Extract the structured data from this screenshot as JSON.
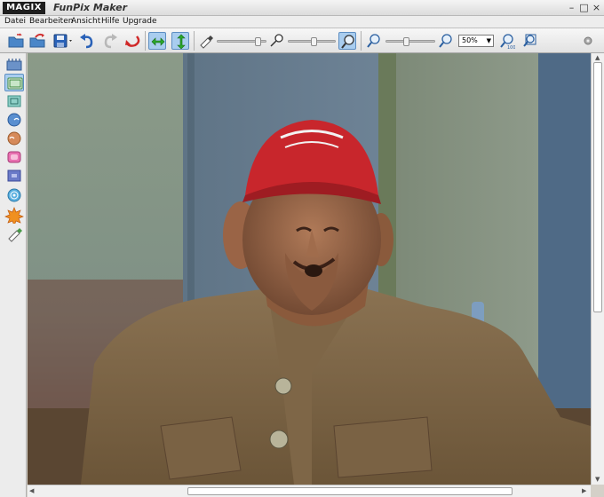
{
  "window": {
    "logo": "MAGIX",
    "title": "FunPix Maker",
    "minimize": "–",
    "maximize": "□",
    "close": "×"
  },
  "menu": {
    "items": [
      "Datei",
      "Bearbeiten",
      "Ansicht",
      "Hilfe",
      "Upgrade"
    ]
  },
  "toolbar": {
    "zoom_value": "50%",
    "zoom_options": [
      "50%"
    ],
    "slider1_level": 0.9,
    "slider2_level": 0.55,
    "slider3_level": 0.4,
    "mirror_horizontal_pressed": true,
    "mirror_vertical_pressed": true,
    "magnifier_pressed": true
  },
  "sidebar": {
    "tools": [
      "warp-tool-icon",
      "stretch-tool-icon",
      "move-tool-icon",
      "swirl-right-icon",
      "swirl-left-icon",
      "bulge-icon",
      "pinch-icon",
      "ripple-icon",
      "explode-icon",
      "eraser-icon"
    ],
    "active_index": 1
  },
  "colors": {
    "accent": "#a9cdef",
    "accent_border": "#5d8ec2",
    "titlebar": "#e8e8e8"
  }
}
